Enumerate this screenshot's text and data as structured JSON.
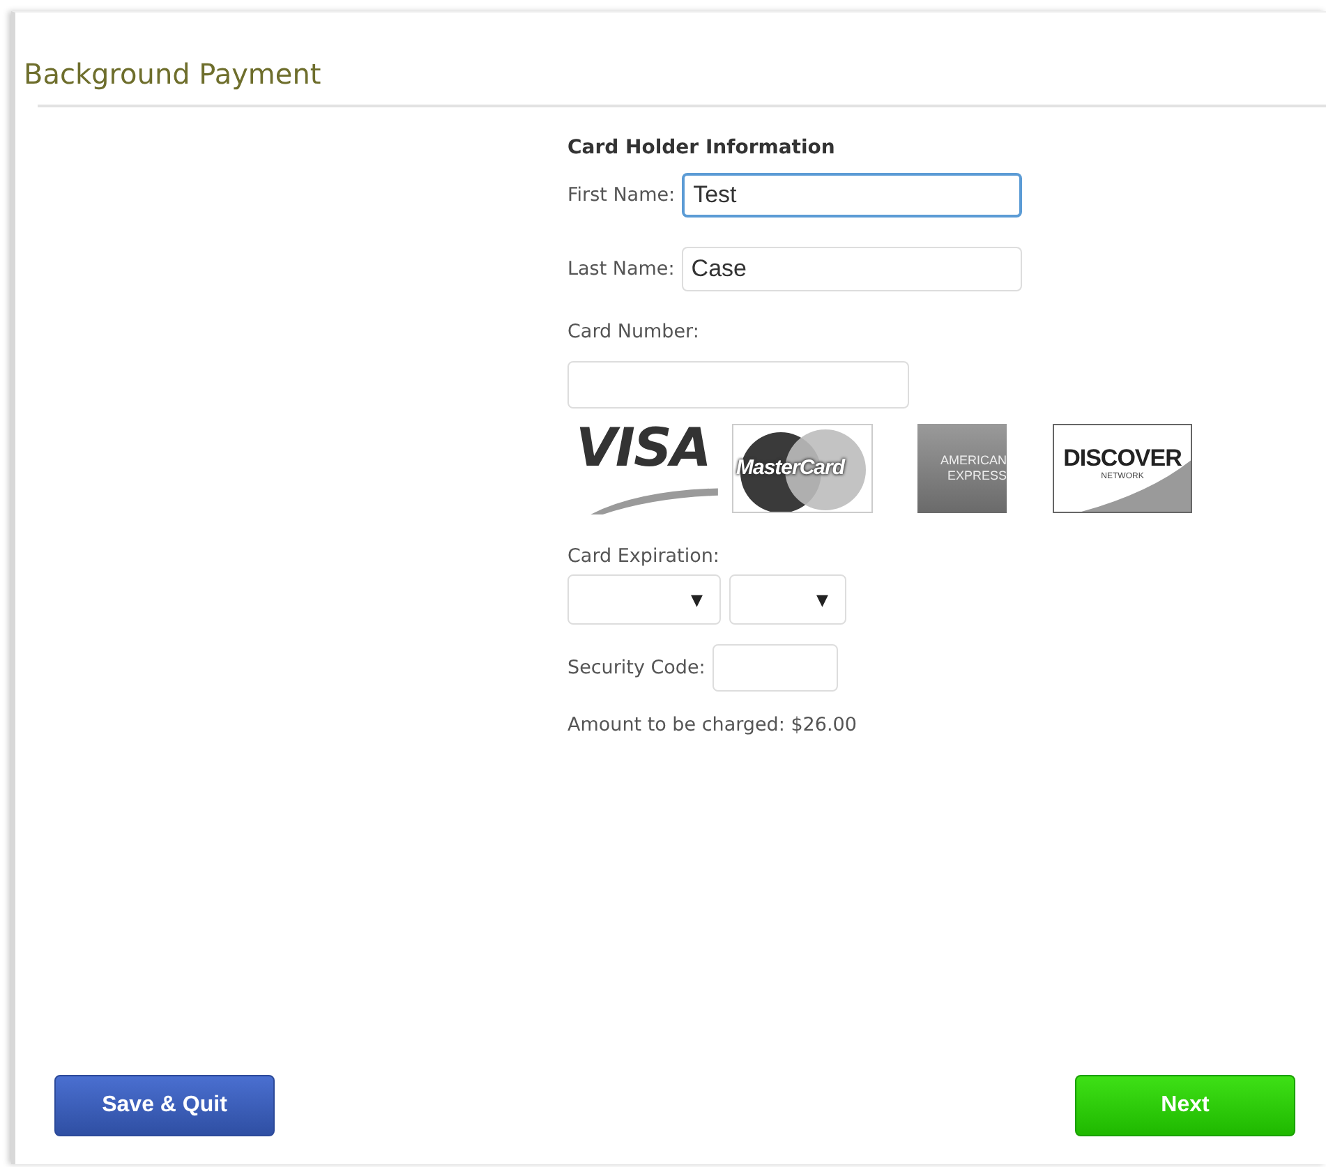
{
  "page": {
    "title": "Background Payment"
  },
  "section": {
    "heading": "Card Holder Information"
  },
  "fields": [
    {
      "kind": "inline",
      "label": "First Name:",
      "value": "Test",
      "focused": true
    },
    {
      "kind": "inline",
      "label": "Last Name:",
      "value": "Case",
      "focused": false
    },
    {
      "kind": "stacked",
      "label": "Card Number:",
      "focused": false
    }
  ],
  "card_logos": [
    {
      "kind": "visa",
      "texts": [
        "VISA"
      ]
    },
    {
      "kind": "mastercard",
      "texts": [
        "MasterCard"
      ]
    },
    {
      "kind": "amex",
      "texts": [
        "AMERICAN",
        "EXPRESS"
      ]
    },
    {
      "kind": "discover",
      "texts": [
        "DISCOVER",
        "NETWORK"
      ]
    }
  ],
  "expiration": {
    "label": "Card Expiration:",
    "selects": [
      {
        "kind": "month",
        "arrow": "▼"
      },
      {
        "kind": "year",
        "arrow": "▼"
      }
    ]
  },
  "security_code": {
    "label": "Security Code:"
  },
  "amount": "Amount to be charged: $26.00",
  "buttons": [
    {
      "kind": "secondary",
      "label": "Save & Quit"
    },
    {
      "kind": "primary",
      "label": "Next"
    }
  ]
}
